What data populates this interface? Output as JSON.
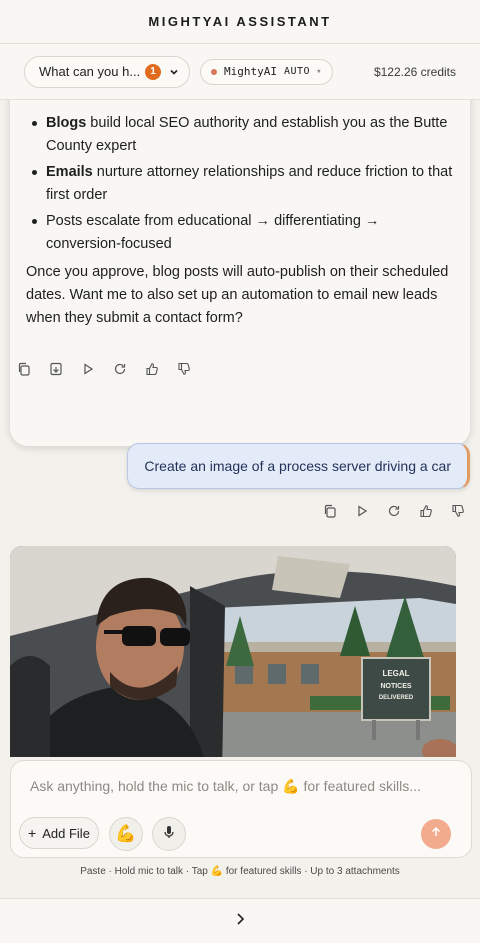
{
  "app": {
    "title": "MIGHTYAI ASSISTANT"
  },
  "toolbar": {
    "conversation_label": "What can you h...",
    "conversation_badge": "1",
    "model_name": "MightyAI",
    "model_mode": "AUTO",
    "credits": "$122.26 credits"
  },
  "assistant_message": {
    "bullets": [
      {
        "bold": "Blogs",
        "text": " build local SEO authority and establish you as the Butte County expert"
      },
      {
        "bold": "Emails",
        "text": " nurture attorney relationships and reduce friction to that first order"
      },
      {
        "bold": "",
        "text": "Posts escalate from educational → differentiating → conversion-focused"
      }
    ],
    "closing": "Once you approve, blog posts will auto-publish on their scheduled dates. Want me to also set up an automation to email new leads when they submit a contact form?"
  },
  "user_message": {
    "text": "Create an image of a process server driving a car"
  },
  "generated_image": {
    "sign_text": [
      "LEGAL",
      "NOTICES",
      "DELIVERED"
    ]
  },
  "composer": {
    "placeholder": "Ask anything, hold the mic to talk, or tap 💪 for featured skills...",
    "add_file_label": "Add File",
    "skills_emoji": "💪"
  },
  "hint": "Paste · Hold mic to talk · Tap 💪 for featured skills · Up to 3 attachments",
  "colors": {
    "accent": "#e06b1f",
    "send": "#f2ab8c",
    "user_bubble": "#e3ebf8"
  }
}
